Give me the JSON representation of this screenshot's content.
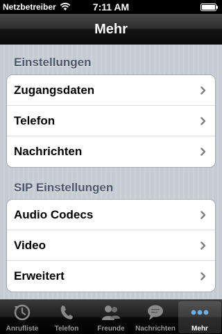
{
  "status_bar": {
    "carrier": "Netzbetreiber",
    "time": "7:11 AM"
  },
  "nav_bar": {
    "title": "Mehr"
  },
  "sections": [
    {
      "header": "Einstellungen",
      "rows": [
        {
          "label": "Zugangsdaten"
        },
        {
          "label": "Telefon"
        },
        {
          "label": "Nachrichten"
        }
      ]
    },
    {
      "header": "SIP Einstellungen",
      "rows": [
        {
          "label": "Audio Codecs"
        },
        {
          "label": "Video"
        },
        {
          "label": "Erweitert"
        }
      ]
    }
  ],
  "tab_bar": {
    "tabs": [
      {
        "label": "Anrufliste",
        "icon": "call-history-icon",
        "active": false
      },
      {
        "label": "Telefon",
        "icon": "phone-icon",
        "active": false
      },
      {
        "label": "Freunde",
        "icon": "contacts-icon",
        "active": false
      },
      {
        "label": "Nachrichten",
        "icon": "chat-bubble-icon",
        "active": false
      },
      {
        "label": "Mehr",
        "icon": "more-icon",
        "active": true
      }
    ]
  },
  "colors": {
    "background": "#c5ccd4",
    "section_header": "#4c566c",
    "active_tab_icon": "#6ab0f3"
  }
}
